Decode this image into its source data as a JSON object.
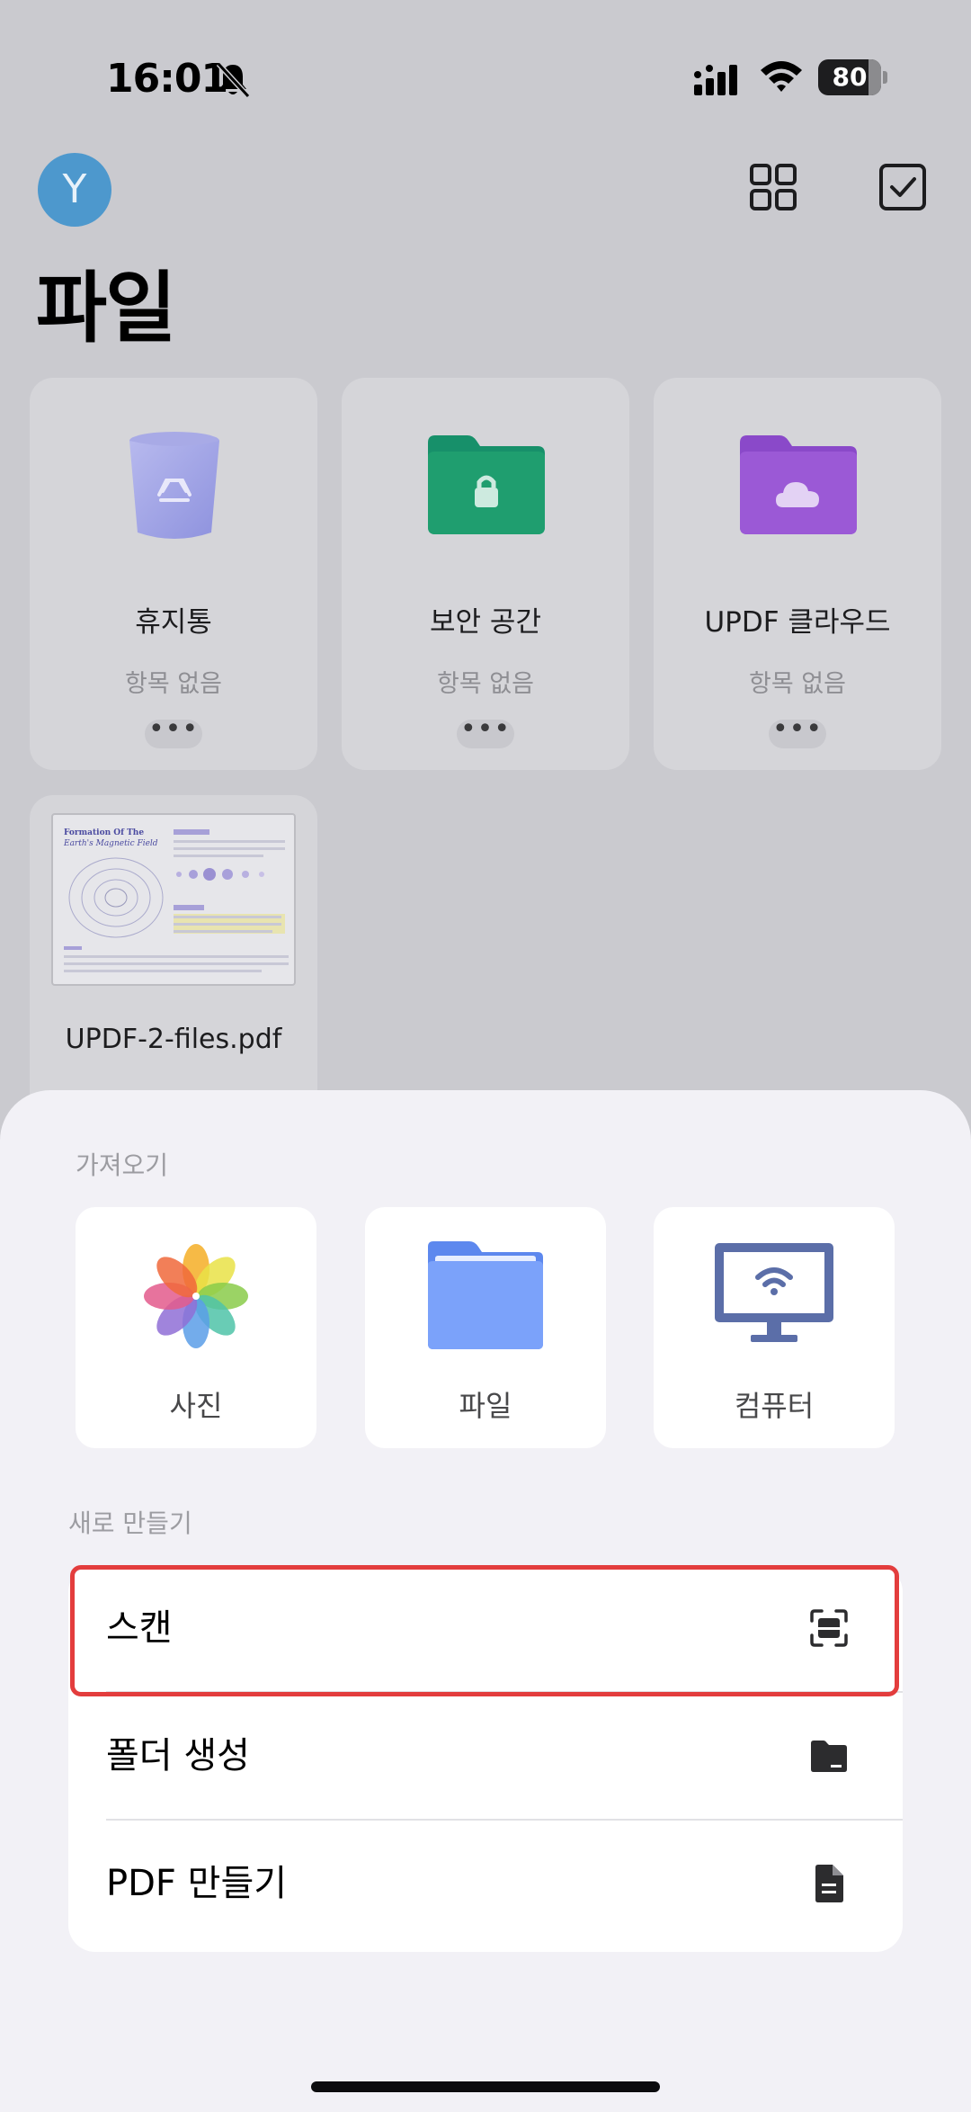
{
  "status_bar": {
    "time": "16:01",
    "battery": "80",
    "battery_level": 0.8
  },
  "header": {
    "avatar_initial": "Y",
    "title": "파일"
  },
  "cards": [
    {
      "title": "휴지통",
      "subtitle": "항목 없음",
      "more": "•••"
    },
    {
      "title": "보안 공간",
      "subtitle": "항목 없음",
      "more": "•••"
    },
    {
      "title": "UPDF 클라우드",
      "subtitle": "항목 없음",
      "more": "•••"
    }
  ],
  "recent_file": {
    "name": "UPDF-2-files.pdf",
    "thumb_title_line1": "Formation Of The",
    "thumb_title_line2": "Earth's Magnetic Field"
  },
  "sheet": {
    "import_label": "가져오기",
    "import_items": [
      {
        "label": "사진",
        "icon": "photos-icon"
      },
      {
        "label": "파일",
        "icon": "files-folder-icon"
      },
      {
        "label": "컴퓨터",
        "icon": "computer-wifi-icon"
      }
    ],
    "new_label": "새로 만들기",
    "new_items": [
      {
        "label": "스캔",
        "icon": "scan-icon"
      },
      {
        "label": "폴더 생성",
        "icon": "folder-icon"
      },
      {
        "label": "PDF 만들기",
        "icon": "document-icon"
      }
    ]
  },
  "colors": {
    "highlight": "#e33d3d",
    "avatar": "#4d98cd",
    "secure_folder": "#1f9e6f",
    "cloud_folder": "#9b59d6",
    "files_folder": "#6e9cf7"
  }
}
